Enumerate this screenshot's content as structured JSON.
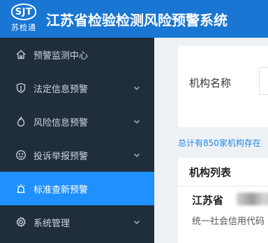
{
  "header": {
    "logo_text": "SJT",
    "logo_subtitle": "苏检通",
    "title": "江苏省检验检测风险预警系统",
    "color": "#1976d2"
  },
  "sidebar": {
    "items": [
      {
        "label": "预警监测中心",
        "icon": "home-icon",
        "has_submenu": false,
        "active": false
      },
      {
        "label": "法定信息预警",
        "icon": "shield-icon",
        "has_submenu": true,
        "active": false
      },
      {
        "label": "风险信息预警",
        "icon": "flame-icon",
        "has_submenu": true,
        "active": false
      },
      {
        "label": "投诉举报预警",
        "icon": "smiley-icon",
        "has_submenu": true,
        "active": false
      },
      {
        "label": "标准查新预警",
        "icon": "alarm-icon",
        "has_submenu": false,
        "active": true
      },
      {
        "label": "系统管理",
        "icon": "gear-icon",
        "has_submenu": true,
        "active": false
      }
    ],
    "background": "#1f2d3d",
    "active_color": "#1e90ff"
  },
  "filter": {
    "label": "机构名称",
    "input_value": ""
  },
  "summary": {
    "text": "总计有850家机构存在"
  },
  "list": {
    "title": "机构列表",
    "items": [
      {
        "name": "江苏省",
        "code_label": "统一社会信用代码"
      }
    ]
  }
}
